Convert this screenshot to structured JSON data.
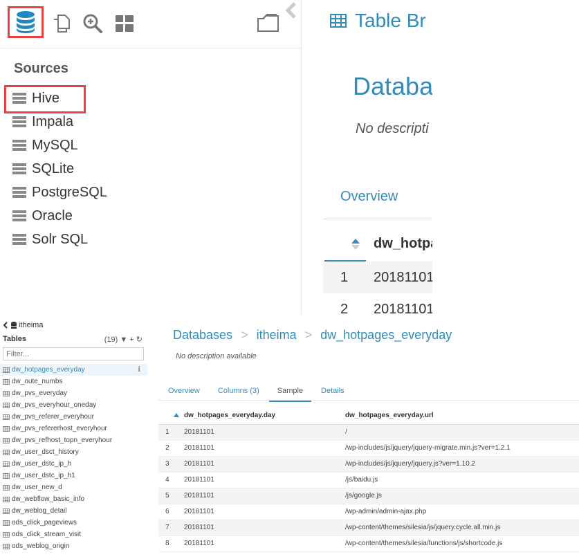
{
  "top": {
    "sources_title": "Sources",
    "sources": [
      "Hive",
      "Impala",
      "MySQL",
      "SQLite",
      "PostgreSQL",
      "Oracle",
      "Solr SQL"
    ],
    "right": {
      "title": "Table Br",
      "db_heading": "Databa",
      "description": "No descripti",
      "tab": "Overview",
      "column_header": "dw_hotpa",
      "rows": [
        {
          "n": "1",
          "v": "20181101"
        },
        {
          "n": "2",
          "v": "20181101"
        }
      ]
    }
  },
  "bottom": {
    "breadcrumb_db": "itheima",
    "tables_label": "Tables",
    "tables_count": "(19)",
    "filter_placeholder": "Filter...",
    "tables": [
      "dw_hotpages_everyday",
      "dw_oute_numbs",
      "dw_pvs_everyday",
      "dw_pvs_everyhour_oneday",
      "dw_pvs_referer_everyhour",
      "dw_pvs_refererhost_everyhour",
      "dw_pvs_refhost_topn_everyhour",
      "dw_user_dsct_history",
      "dw_user_dstc_ip_h",
      "dw_user_dstc_ip_h1",
      "dw_user_new_d",
      "dw_webflow_basic_info",
      "dw_weblog_detail",
      "ods_click_pageviews",
      "ods_click_stream_visit",
      "ods_weblog_origin"
    ],
    "active_table": "dw_hotpages_everyday",
    "breadcrumbs": [
      "Databases",
      "itheima",
      "dw_hotpages_everyday"
    ],
    "description": "No description available",
    "tabs": [
      "Overview",
      "Columns (3)",
      "Sample",
      "Details"
    ],
    "active_tab": "Sample",
    "columns": [
      "dw_hotpages_everyday.day",
      "dw_hotpages_everyday.url"
    ],
    "rows": [
      [
        "1",
        "20181101",
        "/"
      ],
      [
        "2",
        "20181101",
        "/wp-includes/js/jquery/jquery-migrate.min.js?ver=1.2.1"
      ],
      [
        "3",
        "20181101",
        "/wp-includes/js/jquery/jquery.js?ver=1.10.2"
      ],
      [
        "4",
        "20181101",
        "/js/baidu.js"
      ],
      [
        "5",
        "20181101",
        "/js/google.js"
      ],
      [
        "6",
        "20181101",
        "/wp-admin/admin-ajax.php"
      ],
      [
        "7",
        "20181101",
        "/wp-content/themes/silesia/js/jquery.cycle.all.min.js"
      ],
      [
        "8",
        "20181101",
        "/wp-content/themes/silesia/functions/js/shortcode.js"
      ]
    ]
  },
  "colors": {
    "accent": "#338bb8",
    "highlight_box": "#e84141"
  }
}
